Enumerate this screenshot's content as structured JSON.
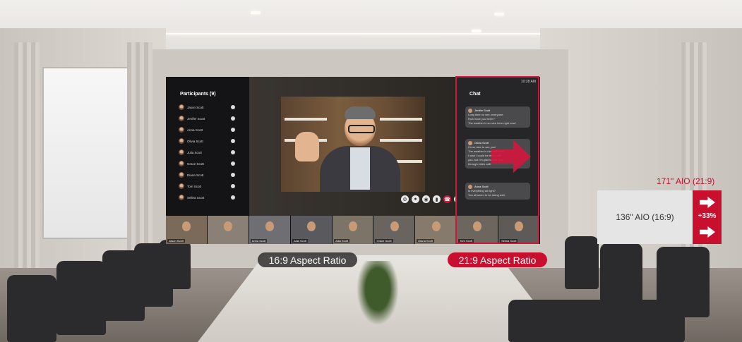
{
  "display": {
    "participants_title": "Participants (9)",
    "participants": [
      "Jason Scott",
      "Jenifer Scott",
      "Anna Scott",
      "Olivia Scott",
      "Julia Scott",
      "Grace Scott",
      "Diana Scott",
      "Tom Scott",
      "Selina Scott"
    ],
    "chat_title": "Chat",
    "time": "10:38 AM",
    "chat_messages": [
      {
        "name": "Jenifer Scott",
        "lines": [
          "Long time no see, everyone.",
          "How have you been?",
          "The weather is so nice here right now!"
        ]
      },
      {
        "name": "Olivia Scott",
        "lines": [
          "It's so nice to see you!",
          "The weather is nice here too.",
          "I wish I could be there with",
          "you, but I'm glad to see you",
          "through video call!"
        ]
      },
      {
        "name": "Anna Scott",
        "lines": [
          "Is everything all right?",
          "You all seem to be doing well."
        ]
      }
    ],
    "controls": [
      "gear-icon",
      "person-icon",
      "camera-icon",
      "mic-icon",
      "hangup-icon",
      "minus-icon"
    ],
    "thumbnails": [
      "Jason Scott",
      "",
      "Anna Scott",
      "Julia Scott",
      "Julia Scott",
      "Grace Scott",
      "Diana Scott",
      "Tom Scott",
      "Selina Scott"
    ]
  },
  "labels": {
    "ratio_169": "16:9 Aspect Ratio",
    "ratio_219": "21:9 Aspect Ratio"
  },
  "comparison": {
    "title": "171\" AIO (21:9)",
    "box_label": "136\" AIO (16:9)",
    "increase": "+33%"
  },
  "colors": {
    "accent": "#c8102e",
    "pill_dark": "#2a2a2a"
  }
}
